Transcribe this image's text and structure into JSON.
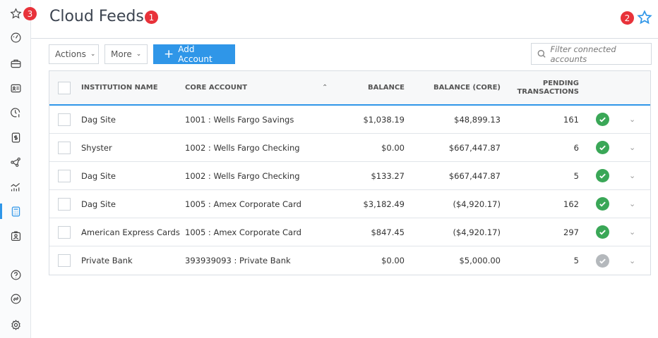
{
  "sidebar": {
    "items": [
      {
        "icon": "star-icon"
      },
      {
        "icon": "dashboard-icon"
      },
      {
        "icon": "briefcase-icon"
      },
      {
        "icon": "contact-card-icon"
      },
      {
        "icon": "clock-dollar-icon"
      },
      {
        "icon": "invoice-icon"
      },
      {
        "icon": "network-icon"
      },
      {
        "icon": "chart-icon"
      },
      {
        "icon": "calculator-icon",
        "active": true
      },
      {
        "icon": "badge-id-icon"
      },
      {
        "icon": "help-icon"
      },
      {
        "icon": "link-icon"
      },
      {
        "icon": "settings-icon"
      }
    ],
    "badge": "3"
  },
  "header": {
    "title": "Cloud Feeds",
    "title_badge": "1",
    "favorite_badge": "2"
  },
  "toolbar": {
    "actions_label": "Actions",
    "more_label": "More",
    "add_label": "Add Account",
    "search_placeholder": "Filter connected accounts"
  },
  "colors": {
    "accent": "#2f96e8",
    "success": "#3aa757",
    "badge": "#e8323a"
  },
  "table": {
    "headers": {
      "institution": "INSTITUTION NAME",
      "core": "CORE ACCOUNT",
      "balance": "BALANCE",
      "balance_core": "BALANCE (CORE)",
      "pending1": "PENDING",
      "pending2": "TRANSACTIONS"
    },
    "rows": [
      {
        "institution": "Dag Site",
        "core": "1001 : Wells Fargo Savings",
        "balance": "$1,038.19",
        "balance_core": "$48,899.13",
        "pending": "161",
        "status": "ok"
      },
      {
        "institution": "Shyster",
        "core": "1002 : Wells Fargo Checking",
        "balance": "$0.00",
        "balance_core": "$667,447.87",
        "pending": "6",
        "status": "ok"
      },
      {
        "institution": "Dag Site",
        "core": "1002 : Wells Fargo Checking",
        "balance": "$133.27",
        "balance_core": "$667,447.87",
        "pending": "5",
        "status": "ok"
      },
      {
        "institution": "Dag Site",
        "core": "1005 : Amex Corporate Card",
        "balance": "$3,182.49",
        "balance_core": "($4,920.17)",
        "pending": "162",
        "status": "ok"
      },
      {
        "institution": "American Express Cards",
        "core": "1005 : Amex Corporate Card",
        "balance": "$847.45",
        "balance_core": "($4,920.17)",
        "pending": "297",
        "status": "ok"
      },
      {
        "institution": "Private Bank",
        "core": "393939093 : Private Bank",
        "balance": "$0.00",
        "balance_core": "$5,000.00",
        "pending": "5",
        "status": "inactive"
      }
    ]
  }
}
